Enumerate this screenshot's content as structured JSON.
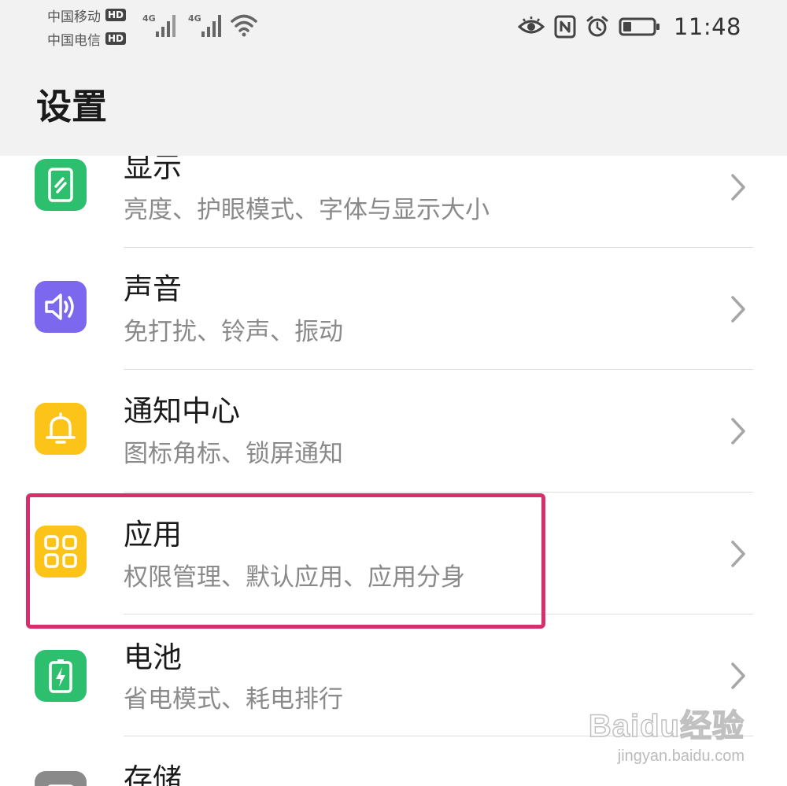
{
  "status_bar": {
    "carrier_1": "中国移动",
    "carrier_2": "中国电信",
    "hd_badge": "HD",
    "network_type": "4G",
    "time": "11:48"
  },
  "header": {
    "title": "设置"
  },
  "settings_items": [
    {
      "title": "显示",
      "subtitle": "亮度、护眼模式、字体与显示大小",
      "icon": "display-icon",
      "icon_color": "#2dbf6e"
    },
    {
      "title": "声音",
      "subtitle": "免打扰、铃声、振动",
      "icon": "sound-icon",
      "icon_color": "#7b68ee"
    },
    {
      "title": "通知中心",
      "subtitle": "图标角标、锁屏通知",
      "icon": "bell-icon",
      "icon_color": "#fcc419"
    },
    {
      "title": "应用",
      "subtitle": "权限管理、默认应用、应用分身",
      "icon": "apps-grid-icon",
      "icon_color": "#fcc419"
    },
    {
      "title": "电池",
      "subtitle": "省电模式、耗电排行",
      "icon": "battery-icon",
      "icon_color": "#2dbf6e"
    },
    {
      "title": "存储",
      "subtitle": "",
      "icon": "storage-icon",
      "icon_color": "#8a8a8a"
    }
  ],
  "highlight_color": "#d62f6e",
  "watermark": {
    "brand": "Baidu经验",
    "url": "jingyan.baidu.com"
  }
}
